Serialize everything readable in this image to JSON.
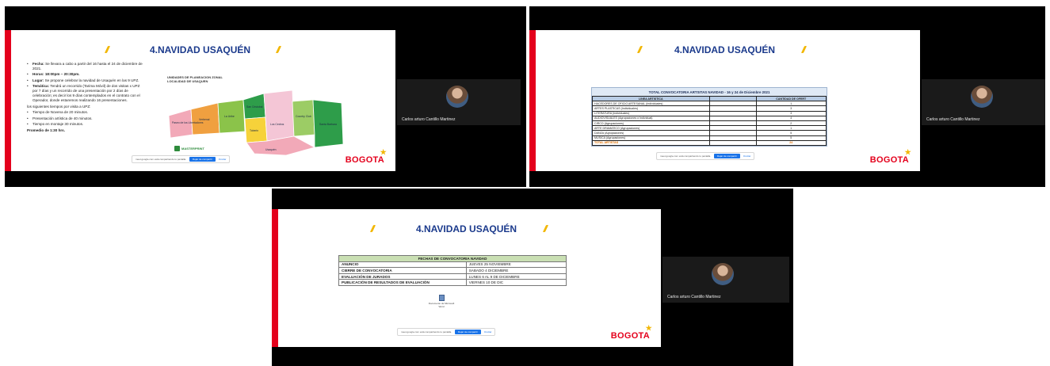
{
  "brand": {
    "logo_text": "BOGOTA",
    "accent_red": "#e4001c",
    "title_blue": "#1b3a8c",
    "deco_yellow": "#f2b705"
  },
  "share_bar": {
    "message": "meet.google.com está compartiendo tu pantalla.",
    "stop_label": "Dejar de compartir",
    "hide_label": "Ocultar"
  },
  "participant": {
    "name": "Carlos arturo Cantillo Martinez",
    "icon": "person-avatar"
  },
  "slide1": {
    "title": "4.NAVIDAD USAQUÉN",
    "bullets": [
      {
        "label": "Fecha:",
        "text": " Se llevara a cabo a partir del 16 hasta el 24 de diciembre de 2021."
      },
      {
        "label": "Horas: 18:00pm – 20:30pm.",
        "text": ""
      },
      {
        "label": "Lugar:",
        "text": " Se propone celebrar la navidad de Usaquén en las 9 UPZ."
      },
      {
        "label": "Temática:",
        "text": " Tendrá un recorrido (Tarima Móvil) de dos visitas x UPZ por 7 días y un recorrido de una presentación por 2 días de celebración; es decir los 9 días contemplados en el contrato con el Operador, donde estaremos realizando 16 presentaciones."
      }
    ],
    "subheading": "los siguientes tiempos por visita a UPZ:",
    "times": [
      "Tiempo de Novena de 20 minutos.",
      "Presentación artística de 40 minutos.",
      "Tiempo en montaje 30 minutos."
    ],
    "average": "Promedio de 1:30 hrs.",
    "map": {
      "title": "UNIDADES DE PLANEACION ZONAL LOCALIDAD DE USAQUEN",
      "zones": [
        "Paseo de los Libertadores",
        "Verbenal",
        "La Uribe",
        "San Cristobal",
        "Toberin",
        "Los Cedros",
        "Country Club",
        "Santa Barbara",
        "Usaquén"
      ],
      "logo_text": "MASTERPRINT"
    }
  },
  "slide2": {
    "title": "4.NAVIDAD USAQUÉN",
    "table_caption": "TOTAL CONVOCATORIA ARTSITAS NAVIDAD - 16 y 24 de Diciembre 2021",
    "columns": [
      "LINEA ARTISTICA",
      "",
      "CANTIDAD DE OFERT"
    ],
    "rows": [
      {
        "line": "HACEDORES DE OFICIO ARTESANAL (Individuales)",
        "qty": "1"
      },
      {
        "line": "ARTES PLASTICAS (Individuales)",
        "qty": "3"
      },
      {
        "line": "LITERATURA (Individuales)",
        "qty": "3"
      },
      {
        "line": "AUDIOVISUALES (Agrupaciones o Individual)",
        "qty": "4"
      },
      {
        "line": "CIRCO (Agrupaciones)",
        "qty": "2"
      },
      {
        "line": "ARTE DRAMATICO (Agrupaciones)",
        "qty": "1"
      },
      {
        "line": "DANZA (Agrupaciones)",
        "qty": "5"
      },
      {
        "line": "MUSICA (Agrupaciones)",
        "qty": "5"
      },
      {
        "line": "TOTAL ARTISTAS",
        "qty": "24"
      }
    ]
  },
  "slide3": {
    "title": "4.NAVIDAD USAQUÉN",
    "table_caption": "FECHAS DE CONVOCATORIA NAVIDAD",
    "rows": [
      {
        "event": "ANUNCIO",
        "date": "JUEVES 25 NOVIEMBRE"
      },
      {
        "event": "CIERRE DE CONVOCATORIA",
        "date": "SABADO 4 DICIEMBRE"
      },
      {
        "event": "EVALUACIÓN DE JURADOS",
        "date": "LUNES 6 AL 9 DE DICIEMBRE"
      },
      {
        "event": "PUBLICACIÓN DE RESULTADOS DE EVALUACIÓN",
        "date": "VIERNES 10 DE DIC"
      }
    ],
    "attachment_caption": "Documento de Microsoft Word"
  }
}
